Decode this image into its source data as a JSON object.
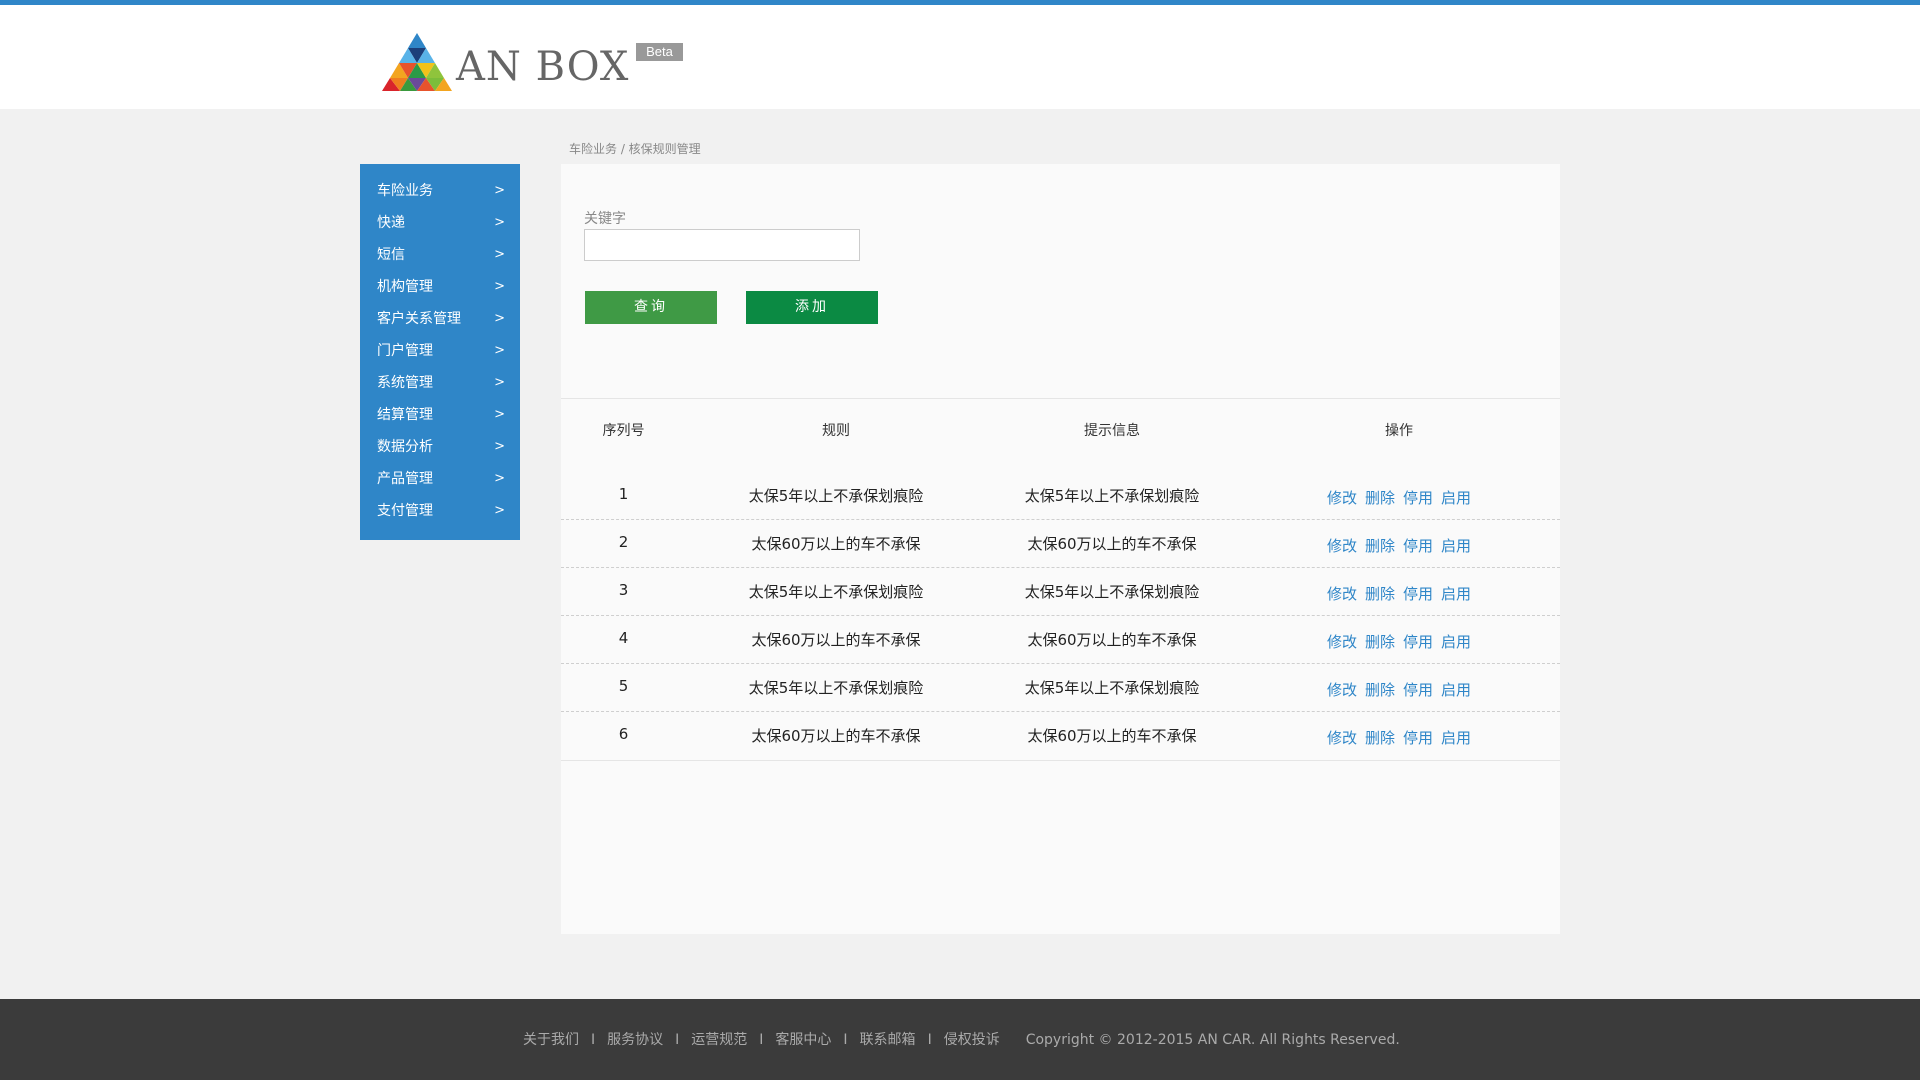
{
  "header": {
    "brand": "AN BOX",
    "badge": "Beta"
  },
  "breadcrumb": "车险业务 / 核保规则管理",
  "sidebar": {
    "items": [
      {
        "label": "车险业务",
        "chevron": ">"
      },
      {
        "label": "快递",
        "chevron": ">"
      },
      {
        "label": "短信",
        "chevron": ">"
      },
      {
        "label": "机构管理",
        "chevron": ">"
      },
      {
        "label": "客户关系管理",
        "chevron": ">"
      },
      {
        "label": "门户管理",
        "chevron": ">"
      },
      {
        "label": "系统管理",
        "chevron": ">"
      },
      {
        "label": "结算管理",
        "chevron": ">"
      },
      {
        "label": "数据分析",
        "chevron": ">"
      },
      {
        "label": "产品管理",
        "chevron": ">"
      },
      {
        "label": "支付管理",
        "chevron": ">"
      }
    ]
  },
  "search": {
    "label": "关键字",
    "value": "",
    "placeholder": ""
  },
  "buttons": {
    "query": "查询",
    "add": "添加"
  },
  "table": {
    "headers": [
      "序列号",
      "规则",
      "提示信息",
      "操作"
    ],
    "actions": [
      "修改",
      "删除",
      "停用",
      "启用"
    ],
    "rows": [
      {
        "id": "1",
        "rule": "太保5年以上不承保划痕险",
        "tip": "太保5年以上不承保划痕险"
      },
      {
        "id": "2",
        "rule": "太保60万以上的车不承保",
        "tip": "太保60万以上的车不承保"
      },
      {
        "id": "3",
        "rule": "太保5年以上不承保划痕险",
        "tip": "太保5年以上不承保划痕险"
      },
      {
        "id": "4",
        "rule": "太保60万以上的车不承保",
        "tip": "太保60万以上的车不承保"
      },
      {
        "id": "5",
        "rule": "太保5年以上不承保划痕险",
        "tip": "太保5年以上不承保划痕险"
      },
      {
        "id": "6",
        "rule": "太保60万以上的车不承保",
        "tip": "太保60万以上的车不承保"
      }
    ]
  },
  "footer": {
    "links": [
      "关于我们",
      "服务协议",
      "运营规范",
      "客服中心",
      "联系邮箱",
      "侵权投诉"
    ],
    "separator": "I",
    "copyright": "Copyright © 2012-2015 AN CAR.  All Rights Reserved."
  },
  "colors": {
    "accent": "#2f86c8",
    "query_button": "#3f9a45",
    "add_button": "#0b8a43",
    "footer_bg": "#3b3b3b"
  }
}
